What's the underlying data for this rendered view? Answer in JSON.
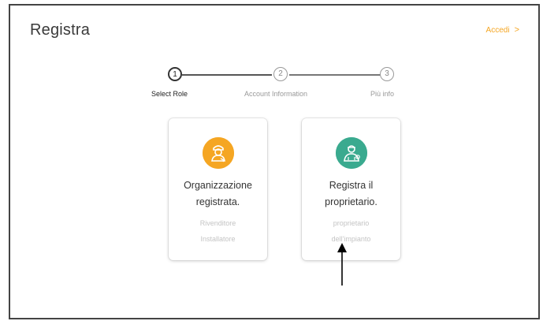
{
  "header": {
    "title": "Registra",
    "login_label": "Accedi",
    "login_chevron": ">"
  },
  "stepper": {
    "steps": [
      {
        "number": "1",
        "label": "Select Role",
        "state": "active"
      },
      {
        "number": "2",
        "label": "Account Information",
        "state": "inactive"
      },
      {
        "number": "3",
        "label": "Più info",
        "state": "inactive"
      }
    ]
  },
  "cards": [
    {
      "title_line1": "Organizzazione",
      "title_line2": "registrata.",
      "sub_line1": "Rivenditore",
      "sub_line2": "Installatore",
      "icon": "installer-person-icon",
      "icon_color": "#f5a623"
    },
    {
      "title_line1": "Registra il",
      "title_line2": "proprietario.",
      "sub_line1": "proprietario",
      "sub_line2": "dell'impianto",
      "icon": "owner-person-icon",
      "icon_color": "#3aaa8f"
    }
  ],
  "colors": {
    "accent": "#f5a623",
    "owner": "#3aaa8f",
    "border": "#444444"
  }
}
